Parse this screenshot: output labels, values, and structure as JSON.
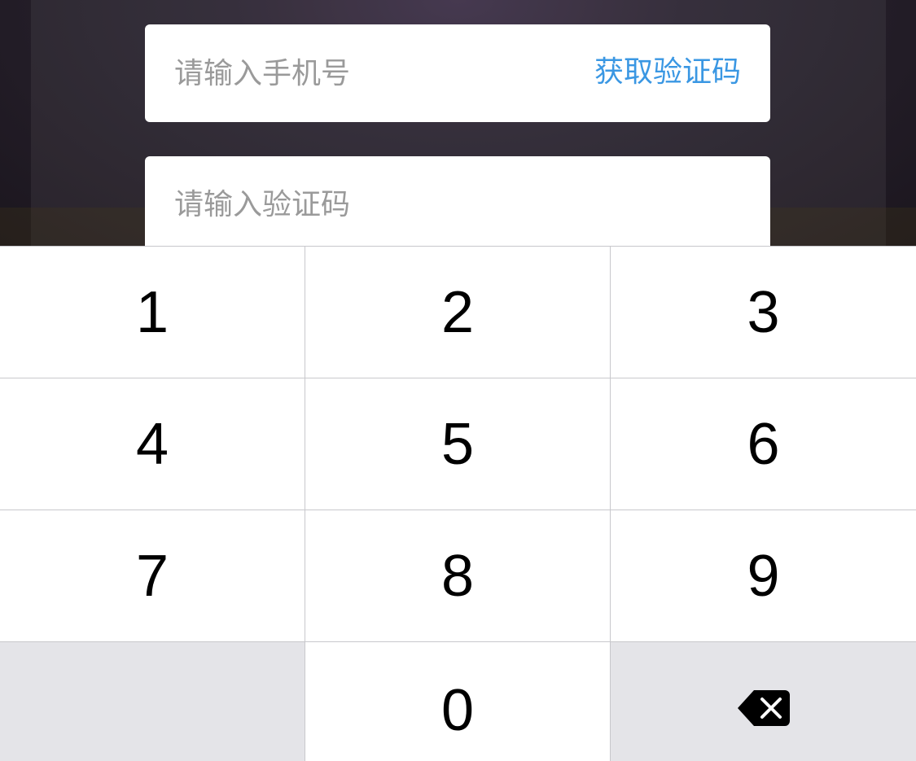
{
  "form": {
    "phone_placeholder": "请输入手机号",
    "get_code_label": "获取验证码",
    "code_placeholder": "请输入验证码",
    "accent_color": "#3a97e3"
  },
  "keypad": {
    "keys": [
      {
        "label": "1"
      },
      {
        "label": "2"
      },
      {
        "label": "3"
      },
      {
        "label": "4"
      },
      {
        "label": "5"
      },
      {
        "label": "6"
      },
      {
        "label": "7"
      },
      {
        "label": "8"
      },
      {
        "label": "9"
      },
      {
        "label": ""
      },
      {
        "label": "0"
      },
      {
        "icon": "backspace-icon"
      }
    ]
  }
}
